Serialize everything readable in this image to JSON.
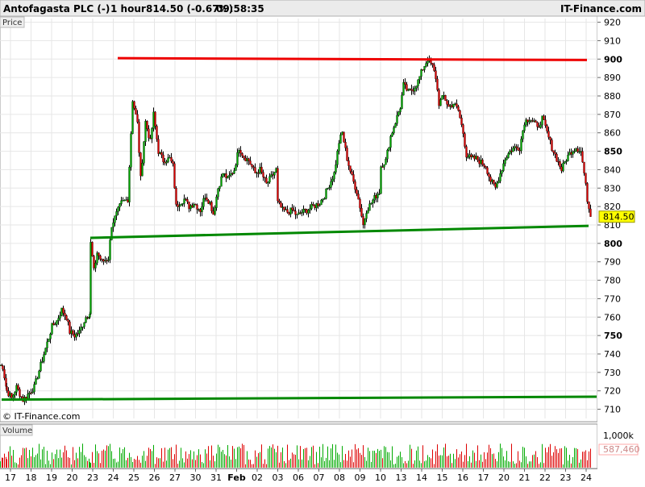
{
  "header": {
    "instrument": "Antofagasta PLC (-)",
    "timeframe": "1 hour",
    "last": "814.50 (-0.67%)",
    "time": "09:58:35",
    "brand": "IT-Finance.com"
  },
  "price_panel": {
    "label": "Price",
    "copyright": "© IT-Finance.com",
    "last_price_tag": "814.50"
  },
  "volume_panel": {
    "label": "Volume",
    "max_tag": "1,000k",
    "last_volume_tag": "587,460"
  },
  "colors": {
    "up": "#00aa00",
    "down": "#dd0000",
    "resistance": "#ee0000",
    "support": "#008800",
    "grid": "#e6e6e6",
    "price_tag_bg": "#ffff00"
  },
  "chart_data": {
    "type": "candlestick",
    "title": "Antofagasta PLC (-) 1 hour",
    "ylim": [
      705,
      922
    ],
    "y_ticks": [
      710,
      720,
      730,
      740,
      750,
      760,
      770,
      780,
      790,
      800,
      810,
      820,
      830,
      840,
      850,
      860,
      870,
      880,
      890,
      900,
      910,
      920
    ],
    "y_ticks_bold": [
      750,
      800,
      850,
      900
    ],
    "x_labels": [
      "17",
      "18",
      "19",
      "20",
      "23",
      "24",
      "25",
      "26",
      "27",
      "30",
      "31",
      "Feb",
      "02",
      "03",
      "06",
      "07",
      "08",
      "09",
      "10",
      "13",
      "14",
      "15",
      "16",
      "17",
      "20",
      "21",
      "22",
      "23",
      "24"
    ],
    "last_price": 814.5,
    "anchors": [
      [
        0,
        734
      ],
      [
        3,
        733
      ],
      [
        8,
        720
      ],
      [
        14,
        716
      ],
      [
        20,
        722
      ],
      [
        28,
        715
      ],
      [
        34,
        718
      ],
      [
        42,
        722
      ],
      [
        50,
        734
      ],
      [
        58,
        746
      ],
      [
        64,
        755
      ],
      [
        70,
        758
      ],
      [
        76,
        764
      ],
      [
        82,
        760
      ],
      [
        86,
        752
      ],
      [
        92,
        750
      ],
      [
        98,
        752
      ],
      [
        106,
        760
      ],
      [
        111,
        762
      ],
      [
        112,
        800
      ],
      [
        116,
        785
      ],
      [
        120,
        795
      ],
      [
        126,
        790
      ],
      [
        134,
        792
      ],
      [
        138,
        810
      ],
      [
        144,
        816
      ],
      [
        150,
        822
      ],
      [
        158,
        824
      ],
      [
        164,
        878
      ],
      [
        170,
        865
      ],
      [
        174,
        835
      ],
      [
        180,
        866
      ],
      [
        186,
        855
      ],
      [
        190,
        870
      ],
      [
        196,
        850
      ],
      [
        202,
        845
      ],
      [
        210,
        846
      ],
      [
        214,
        842
      ],
      [
        218,
        820
      ],
      [
        222,
        822
      ],
      [
        228,
        824
      ],
      [
        234,
        820
      ],
      [
        240,
        822
      ],
      [
        248,
        818
      ],
      [
        254,
        826
      ],
      [
        260,
        822
      ],
      [
        264,
        816
      ],
      [
        270,
        830
      ],
      [
        276,
        838
      ],
      [
        282,
        835
      ],
      [
        290,
        840
      ],
      [
        296,
        852
      ],
      [
        302,
        847
      ],
      [
        308,
        845
      ],
      [
        316,
        838
      ],
      [
        322,
        840
      ],
      [
        330,
        832
      ],
      [
        336,
        836
      ],
      [
        342,
        840
      ],
      [
        344,
        822
      ],
      [
        350,
        818
      ],
      [
        356,
        817
      ],
      [
        362,
        818
      ],
      [
        368,
        815
      ],
      [
        374,
        817
      ],
      [
        380,
        818
      ],
      [
        388,
        820
      ],
      [
        396,
        822
      ],
      [
        402,
        826
      ],
      [
        408,
        832
      ],
      [
        414,
        838
      ],
      [
        420,
        855
      ],
      [
        424,
        860
      ],
      [
        430,
        846
      ],
      [
        436,
        836
      ],
      [
        442,
        828
      ],
      [
        446,
        820
      ],
      [
        450,
        810
      ],
      [
        454,
        818
      ],
      [
        460,
        822
      ],
      [
        466,
        826
      ],
      [
        470,
        828
      ],
      [
        472,
        842
      ],
      [
        478,
        845
      ],
      [
        484,
        858
      ],
      [
        490,
        866
      ],
      [
        496,
        874
      ],
      [
        500,
        886
      ],
      [
        506,
        882
      ],
      [
        512,
        884
      ],
      [
        518,
        888
      ],
      [
        524,
        895
      ],
      [
        530,
        900
      ],
      [
        536,
        896
      ],
      [
        540,
        890
      ],
      [
        544,
        876
      ],
      [
        550,
        880
      ],
      [
        556,
        874
      ],
      [
        562,
        876
      ],
      [
        568,
        872
      ],
      [
        574,
        860
      ],
      [
        578,
        848
      ],
      [
        584,
        846
      ],
      [
        590,
        846
      ],
      [
        596,
        844
      ],
      [
        602,
        842
      ],
      [
        608,
        834
      ],
      [
        614,
        830
      ],
      [
        620,
        838
      ],
      [
        626,
        846
      ],
      [
        632,
        850
      ],
      [
        638,
        852
      ],
      [
        644,
        852
      ],
      [
        650,
        866
      ],
      [
        656,
        868
      ],
      [
        662,
        866
      ],
      [
        666,
        862
      ],
      [
        672,
        868
      ],
      [
        678,
        860
      ],
      [
        684,
        852
      ],
      [
        690,
        846
      ],
      [
        696,
        840
      ],
      [
        702,
        846
      ],
      [
        708,
        850
      ],
      [
        714,
        852
      ],
      [
        720,
        850
      ],
      [
        724,
        838
      ],
      [
        728,
        824
      ],
      [
        732,
        814.5
      ]
    ],
    "volume_scale_max": 1000000,
    "volume_last": 587460,
    "lines": {
      "resistance": {
        "from": [
          146,
          900.5
        ],
        "to": [
          728,
          899.5
        ]
      },
      "support_upper": {
        "from": [
          112,
          803
        ],
        "to": [
          730,
          809.5
        ]
      },
      "support_lower": {
        "from": [
          2,
          715.2
        ],
        "to": [
          740,
          716.8
        ]
      }
    }
  }
}
